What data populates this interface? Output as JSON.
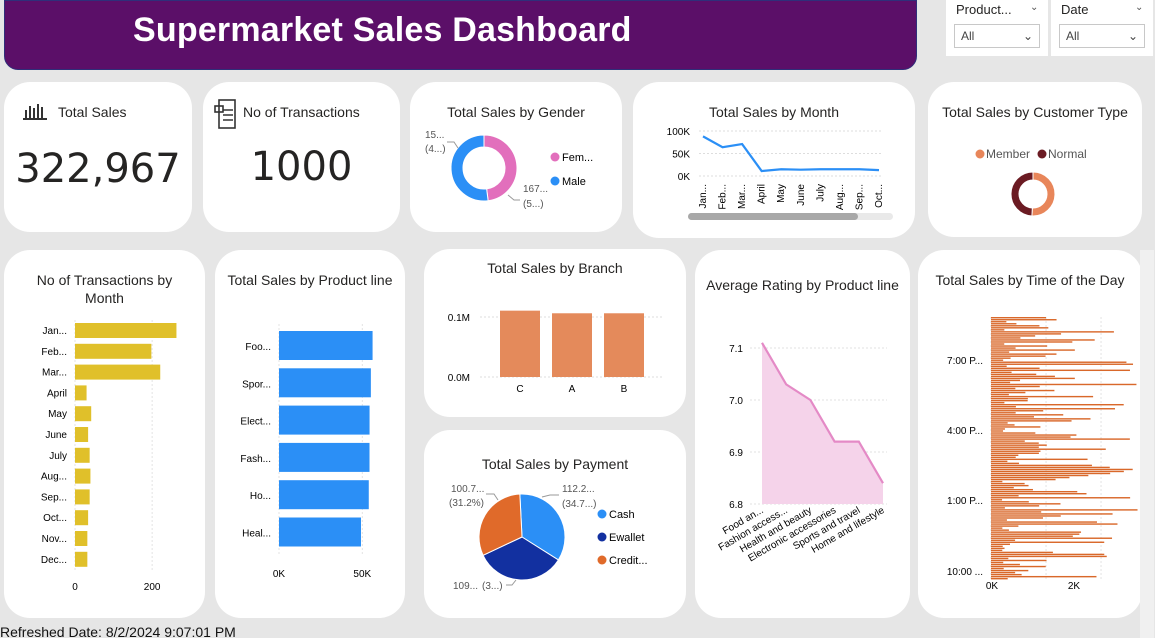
{
  "title": "Supermarket Sales Dashboard",
  "slicers": [
    {
      "label": "Product...",
      "value": "All"
    },
    {
      "label": "Date",
      "value": "All"
    }
  ],
  "kpis": {
    "total_sales": {
      "title": "Total Sales",
      "value": "322,967",
      "icon": "bar-chart-icon"
    },
    "transactions": {
      "title": "No of Transactions",
      "value": "1000",
      "icon": "receipt-icon"
    }
  },
  "footer": "Refreshed Date: 8/2/2024 9:07:01 PM",
  "colors": {
    "banner": "#5b0f68",
    "female": "#e26fbc",
    "male": "#2b8ff6",
    "line": "#2b8ff6",
    "yellow": "#e0c02a",
    "blue_bar": "#2b8ff6",
    "orange": "#e48a5b",
    "rating_line": "#e48ac6",
    "time_bar": "#d9682a",
    "member": "#e8865a",
    "normal": "#6b1b23",
    "cash": "#2b8ff6",
    "ewallet": "#1230a0",
    "credit": "#e06a2a"
  },
  "chart_data": [
    {
      "id": "gender",
      "type": "pie",
      "title": "Total Sales by Gender",
      "legend": [
        "Fem...",
        "Male"
      ],
      "labels": [
        {
          "text": "15...",
          "sub": "(4...)"
        },
        {
          "text": "167...",
          "sub": "(5...)"
        }
      ],
      "values": [
        155000,
        167900
      ]
    },
    {
      "id": "month_line",
      "type": "line",
      "title": "Total Sales by Month",
      "categories": [
        "Jan...",
        "Feb...",
        "Mar...",
        "April",
        "May",
        "June",
        "July",
        "Aug...",
        "Sep...",
        "Oct..."
      ],
      "values": [
        88000,
        64000,
        71000,
        11000,
        15000,
        14000,
        15000,
        15000,
        15000,
        13000
      ],
      "yticks": [
        "100K",
        "50K",
        "0K"
      ],
      "ylim": [
        0,
        100000
      ]
    },
    {
      "id": "customer",
      "type": "pie",
      "title": "Total Sales by Customer Type",
      "legend": [
        "Member",
        "Normal"
      ],
      "values": [
        164000,
        159000
      ]
    },
    {
      "id": "tx_month",
      "type": "bar",
      "title": "No of Transactions by Month",
      "categories": [
        "Jan...",
        "Feb...",
        "Mar...",
        "April",
        "May",
        "June",
        "July",
        "Aug...",
        "Sep...",
        "Oct...",
        "Nov...",
        "Dec..."
      ],
      "values": [
        263,
        198,
        221,
        30,
        42,
        34,
        38,
        40,
        38,
        34,
        32,
        32
      ],
      "xticks": [
        "0",
        "200"
      ],
      "xlim": [
        0,
        280
      ]
    },
    {
      "id": "product",
      "type": "bar",
      "title": "Total Sales by Product line",
      "categories": [
        "Foo...",
        "Spor...",
        "Elect...",
        "Fash...",
        "Ho...",
        "Heal..."
      ],
      "values": [
        56145,
        55123,
        54338,
        54306,
        53862,
        49194
      ],
      "xticks": [
        "0K",
        "50K"
      ],
      "xlim": [
        0,
        60000
      ]
    },
    {
      "id": "branch",
      "type": "bar",
      "title": "Total Sales by Branch",
      "categories": [
        "C",
        "A",
        "B"
      ],
      "values": [
        110569,
        106200,
        106198
      ],
      "yticks": [
        "0.1M",
        "0.0M"
      ],
      "ylim": [
        0,
        130000
      ]
    },
    {
      "id": "payment",
      "type": "pie",
      "title": "Total Sales by Payment",
      "legend": [
        "Cash",
        "Ewallet",
        "Credit..."
      ],
      "values": [
        112200,
        109900,
        100700
      ],
      "labels": [
        {
          "text": "112.2...",
          "sub": "(34.7...)"
        },
        {
          "text": "109...",
          "sub": "(3...)"
        },
        {
          "text": "100.7...",
          "sub": "(31.2%)"
        }
      ]
    },
    {
      "id": "rating",
      "type": "area",
      "title": "Average Rating by Product line",
      "categories": [
        "Food an...",
        "Fashion access...",
        "Health and beauty",
        "Electronic accessories",
        "Sports and travel",
        "Home and lifestyle"
      ],
      "values": [
        7.11,
        7.03,
        7.0,
        6.92,
        6.92,
        6.84
      ],
      "yticks": [
        "7.1",
        "7.0",
        "6.9",
        "6.8"
      ],
      "ylim": [
        6.8,
        7.15
      ]
    },
    {
      "id": "time",
      "type": "bar",
      "title": "Total Sales by Time of the Day",
      "yticks": [
        "7:00 P...",
        "4:00 P...",
        "1:00 P...",
        "10:00 ..."
      ],
      "xticks": [
        "0K",
        "2K"
      ],
      "xlim": [
        0,
        3000
      ]
    }
  ]
}
